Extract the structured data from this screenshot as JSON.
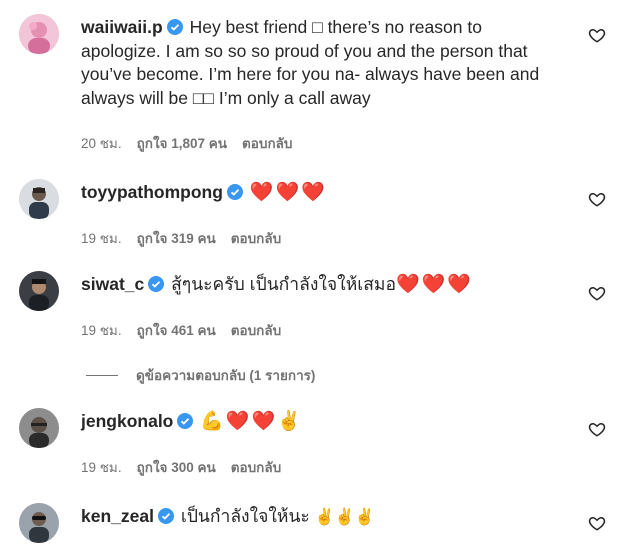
{
  "comments": [
    {
      "username": "waiiwaii.p",
      "text": "Hey best friend □ there’s no reason to apologize. I am so so so proud of you and the person that you’ve become. I’m here for you na- always have been and always will be □□ I’m only a call away",
      "time": "20 ชม.",
      "likes": "ถูกใจ 1,807 คน",
      "reply": "ตอบกลับ"
    },
    {
      "username": "toyypathompong",
      "text": "",
      "emoji": "❤️❤️❤️",
      "time": "19 ชม.",
      "likes": "ถูกใจ 319 คน",
      "reply": "ตอบกลับ"
    },
    {
      "username": "siwat_c",
      "text": "สู้ๆนะครับ เป็นกำลังใจให้เสมอ",
      "emoji": "❤️❤️❤️",
      "time": "19 ชม.",
      "likes": "ถูกใจ 461 คน",
      "reply": "ตอบกลับ"
    },
    {
      "username": "jengkonalo",
      "text": "",
      "emoji": "💪❤️❤️✌️",
      "time": "19 ชม.",
      "likes": "ถูกใจ 300 คน",
      "reply": "ตอบกลับ"
    },
    {
      "username": "ken_zeal",
      "text": "เป็นกำลังใจให้นะ",
      "emoji": "✌️✌️✌️",
      "time": "",
      "likes": "",
      "reply": ""
    }
  ],
  "view_replies": "ดูข้อความตอบกลับ (1 รายการ)",
  "colors": {
    "verified": "#3897f0",
    "heart": "#e0142a",
    "meta": "#737373",
    "text": "#262626"
  },
  "icons": {
    "verified": "verified-badge-icon",
    "like": "heart-outline-icon"
  }
}
